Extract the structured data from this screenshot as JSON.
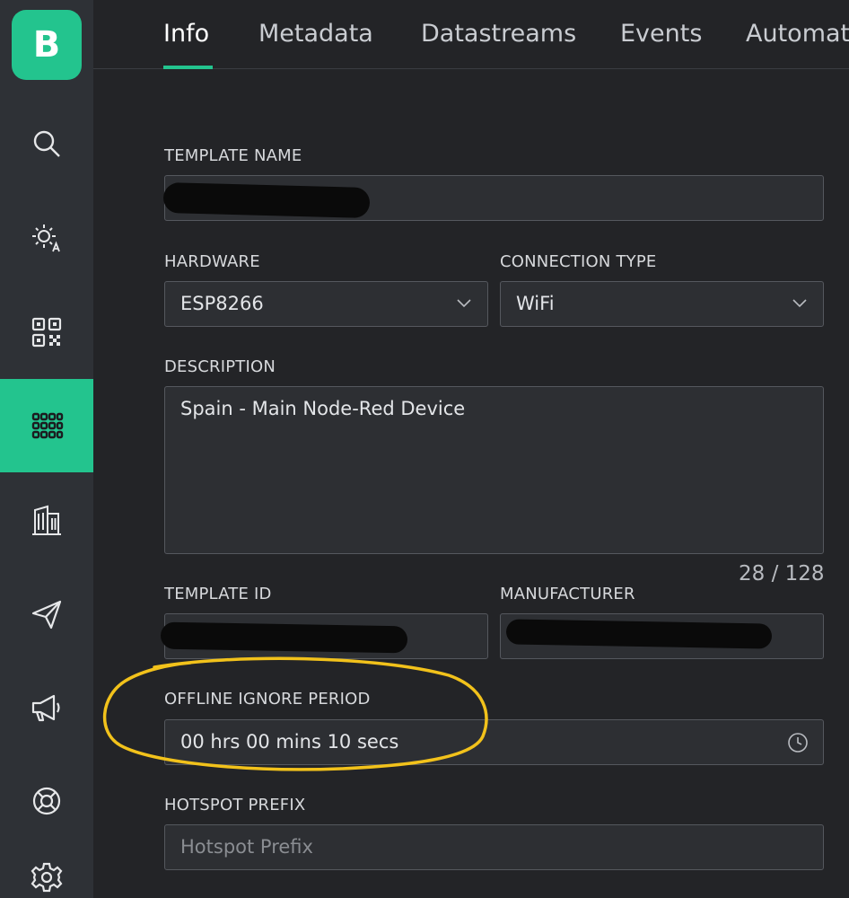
{
  "logo": {
    "letter": "B"
  },
  "sidebar": {
    "items": [
      {
        "name": "search",
        "icon": "search-icon"
      },
      {
        "name": "dashboard",
        "icon": "sun-auto-icon"
      },
      {
        "name": "devices",
        "icon": "qr-code-icon"
      },
      {
        "name": "templates",
        "icon": "grid-icon",
        "active": true
      },
      {
        "name": "organizations",
        "icon": "building-icon"
      },
      {
        "name": "messages",
        "icon": "send-icon"
      },
      {
        "name": "announcements",
        "icon": "megaphone-icon"
      },
      {
        "name": "help",
        "icon": "lifebuoy-icon"
      },
      {
        "name": "settings",
        "icon": "gear-icon"
      }
    ]
  },
  "tabs": [
    {
      "label": "Info",
      "active": true
    },
    {
      "label": "Metadata"
    },
    {
      "label": "Datastreams"
    },
    {
      "label": "Events"
    },
    {
      "label": "Automat"
    }
  ],
  "form": {
    "template_name": {
      "label": "TEMPLATE NAME",
      "value": ""
    },
    "hardware": {
      "label": "HARDWARE",
      "value": "ESP8266"
    },
    "connection_type": {
      "label": "CONNECTION TYPE",
      "value": "WiFi"
    },
    "description": {
      "label": "DESCRIPTION",
      "value": "Spain - Main Node-Red Device",
      "counter": "28 / 128"
    },
    "template_id": {
      "label": "TEMPLATE ID",
      "value": ""
    },
    "manufacturer": {
      "label": "MANUFACTURER",
      "value": ""
    },
    "offline_ignore_period": {
      "label": "OFFLINE IGNORE PERIOD",
      "value": "00 hrs 00 mins 10 secs"
    },
    "hotspot_prefix": {
      "label": "HOTSPOT PREFIX",
      "placeholder": "Hotspot Prefix"
    }
  },
  "colors": {
    "accent": "#23c48e",
    "sidebar": "#2e3136",
    "background": "#232427",
    "annotation": "#f2c21b"
  }
}
